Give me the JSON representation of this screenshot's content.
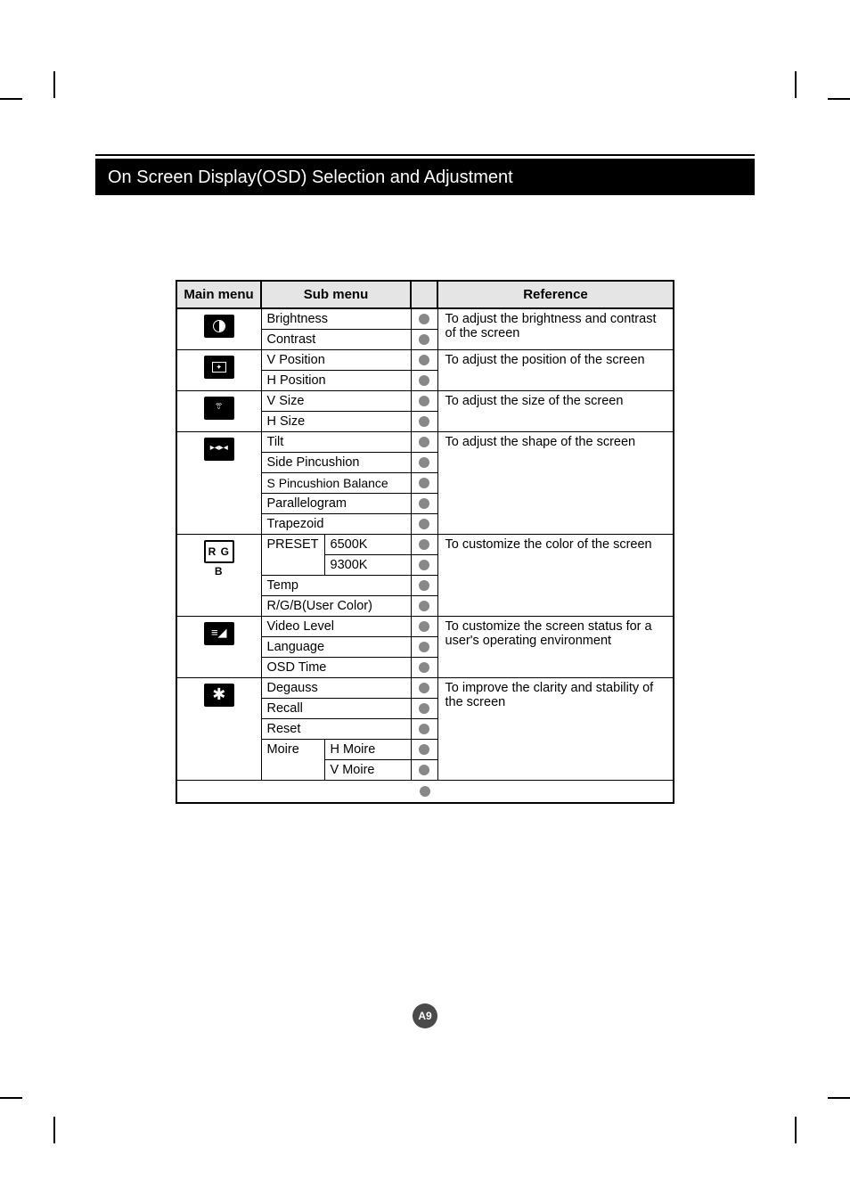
{
  "title": "On Screen Display(OSD) Selection and Adjustment",
  "headers": {
    "main_menu": "Main menu",
    "sub_menu": "Sub menu",
    "reference": "Reference"
  },
  "sections": [
    {
      "icon": "brightness-icon",
      "subs": [
        "Brightness",
        "Contrast"
      ],
      "reference": "To adjust the brightness and contrast of the screen"
    },
    {
      "icon": "position-icon",
      "subs": [
        "V Position",
        "H Position"
      ],
      "reference": "To adjust the position of the screen"
    },
    {
      "icon": "size-icon",
      "subs": [
        "V Size",
        "H Size"
      ],
      "reference": "To adjust the size of the screen"
    },
    {
      "icon": "shape-icon",
      "icon_text": "▸◂▸◂",
      "subs": [
        "Tilt",
        "Side Pincushion",
        "S Pincushion Balance",
        "Parallelogram",
        "Trapezoid"
      ],
      "reference": "To adjust the shape of the screen"
    },
    {
      "icon": "rgb-icon",
      "icon_text": "R G B",
      "nested": {
        "label": "PRESET",
        "items": [
          "6500K",
          "9300K"
        ]
      },
      "subs_after": [
        "Temp",
        "R/G/B(User Color)"
      ],
      "reference": "To customize the color of the screen"
    },
    {
      "icon": "setup-icon",
      "icon_text": "≡◢",
      "subs": [
        "Video Level",
        "Language",
        "OSD Time"
      ],
      "reference": "To customize the screen status for a user's operating environment"
    },
    {
      "icon": "star-icon",
      "icon_text": "✱",
      "subs": [
        "Degauss",
        "Recall",
        "Reset"
      ],
      "nested_after": {
        "label": "Moire",
        "items": [
          "H Moire",
          "V Moire"
        ]
      },
      "reference": "To improve the clarity and stability of the screen"
    }
  ],
  "page_number": "A9"
}
